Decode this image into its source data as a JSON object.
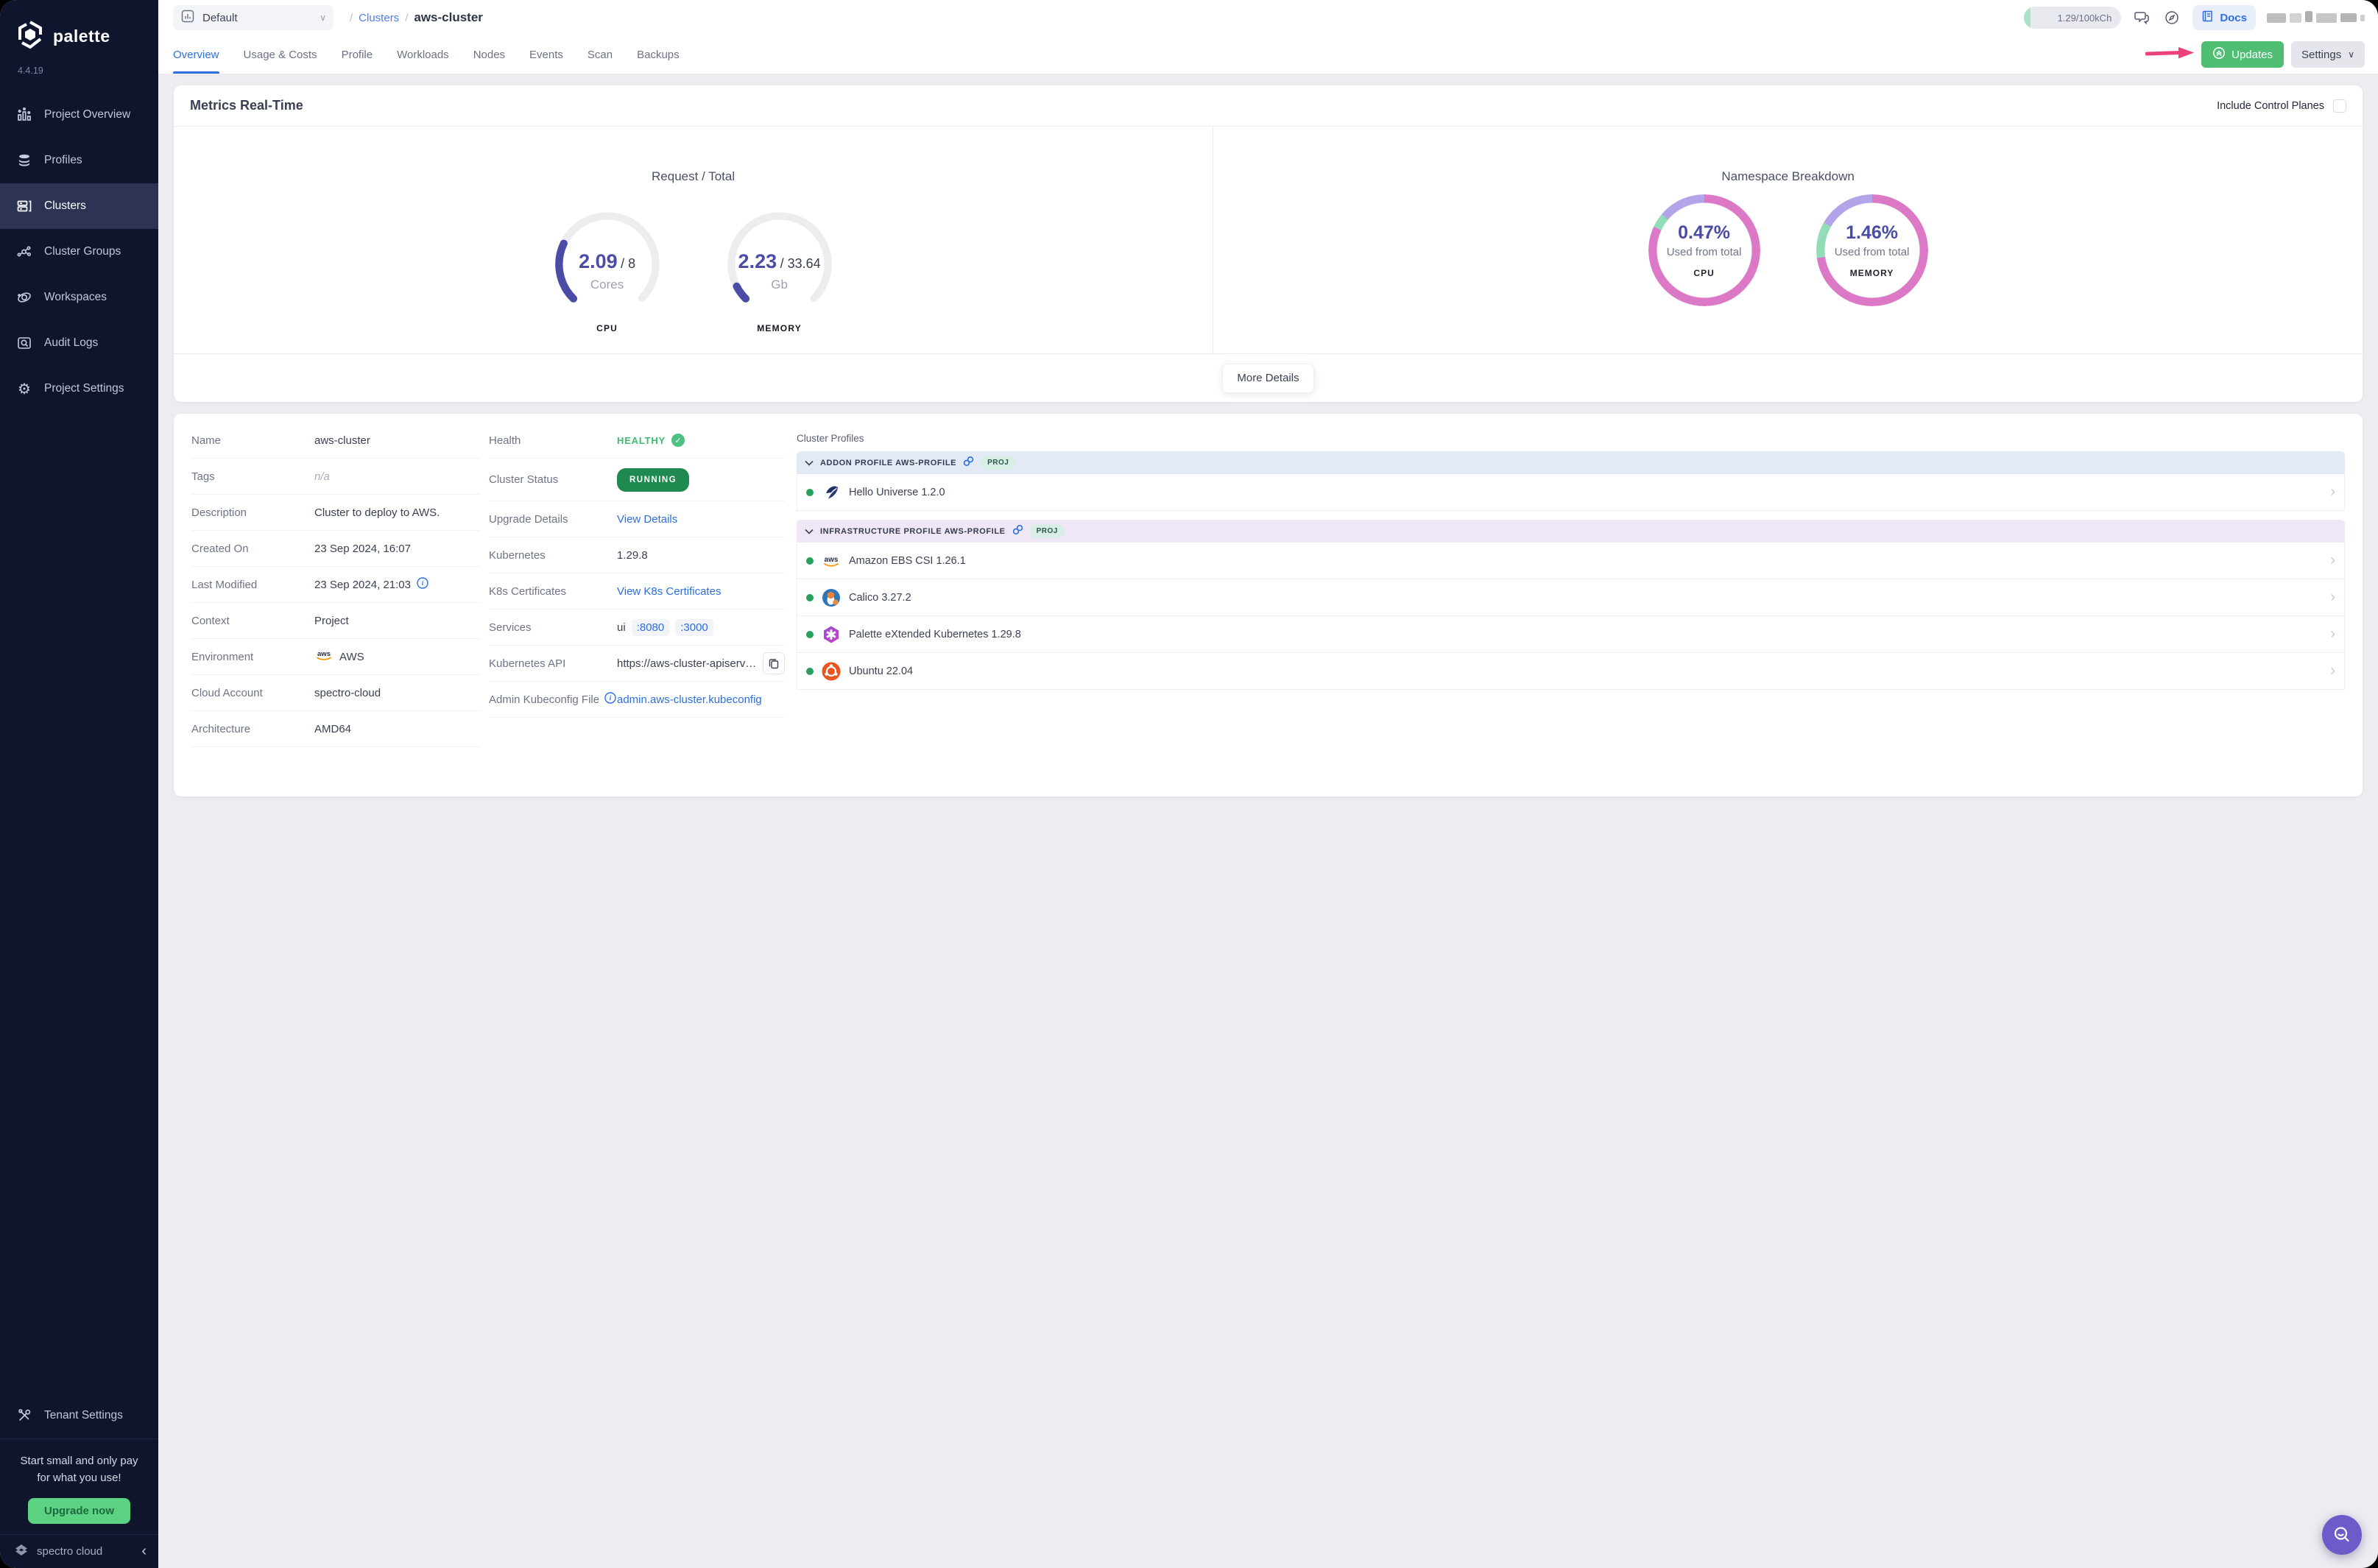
{
  "brand": {
    "name": "palette",
    "version": "4.4.19",
    "footer": "spectro cloud"
  },
  "sidebar": {
    "items": [
      {
        "label": "Project Overview"
      },
      {
        "label": "Profiles"
      },
      {
        "label": "Clusters"
      },
      {
        "label": "Cluster Groups"
      },
      {
        "label": "Workspaces"
      },
      {
        "label": "Audit Logs"
      },
      {
        "label": "Project Settings"
      }
    ],
    "tenant": "Tenant Settings",
    "promo": {
      "line1": "Start small and only pay",
      "line2": "for what you use!",
      "cta": "Upgrade now"
    }
  },
  "topbar": {
    "project": "Default",
    "breadcrumb_sep": "/",
    "breadcrumb_section": "Clusters",
    "breadcrumb_current": "aws-cluster",
    "usage": "1.29/100kCh",
    "docs": "Docs"
  },
  "tabs": {
    "items": [
      "Overview",
      "Usage & Costs",
      "Profile",
      "Workloads",
      "Nodes",
      "Events",
      "Scan",
      "Backups"
    ],
    "updates": "Updates",
    "settings": "Settings"
  },
  "metrics": {
    "title": "Metrics Real-Time",
    "include_control_planes_label": "Include Control Planes",
    "include_control_planes_checked": false,
    "left_title": "Request / Total",
    "right_title": "Namespace Breakdown",
    "gauges": [
      {
        "metric": "CPU",
        "used": 2.09,
        "total": 8,
        "used_label": "2.09",
        "total_label": "/ 8",
        "unit": "Cores"
      },
      {
        "metric": "MEMORY",
        "used": 2.23,
        "total": 33.64,
        "used_label": "2.23",
        "total_label": "/ 33.64",
        "unit": "Gb"
      }
    ],
    "rings": [
      {
        "metric": "CPU",
        "percent": "0.47%",
        "caption": "Used from total",
        "segments": [
          [
            "#DC79C6",
            0,
            295
          ],
          [
            "#92DCB7",
            295,
            310
          ],
          [
            "#B3A3E8",
            310,
            360
          ]
        ]
      },
      {
        "metric": "MEMORY",
        "percent": "1.46%",
        "caption": "Used from total",
        "segments": [
          [
            "#DC79C6",
            0,
            262
          ],
          [
            "#92DCB7",
            262,
            300
          ],
          [
            "#B3A3E8",
            300,
            360
          ]
        ]
      }
    ],
    "more_details": "More Details"
  },
  "details": {
    "rows": [
      {
        "label": "Name",
        "value": "aws-cluster"
      },
      {
        "label": "Tags",
        "value": "n/a"
      },
      {
        "label": "Description",
        "value": "Cluster to deploy to AWS."
      },
      {
        "label": "Created On",
        "value": "23 Sep 2024, 16:07"
      },
      {
        "label": "Last Modified",
        "value": "23 Sep 2024, 21:03"
      },
      {
        "label": "Context",
        "value": "Project"
      },
      {
        "label": "Environment",
        "value": "AWS"
      },
      {
        "label": "Cloud Account",
        "value": "spectro-cloud"
      },
      {
        "label": "Architecture",
        "value": "AMD64"
      }
    ]
  },
  "cluster_status": {
    "health_label": "Health",
    "health_value": "HEALTHY",
    "status_label": "Cluster Status",
    "status_value": "RUNNING",
    "upgrade_label": "Upgrade Details",
    "upgrade_value": "View Details",
    "k8s_label": "Kubernetes",
    "k8s_value": "1.29.8",
    "cert_label": "K8s Certificates",
    "cert_value": "View K8s Certificates",
    "services_label": "Services",
    "services_name": "ui",
    "services_ports": [
      ":8080",
      ":3000"
    ],
    "api_label": "Kubernetes API",
    "api_value": "https://aws-cluster-apiserve...",
    "kubeconfig_label": "Admin Kubeconfig File",
    "kubeconfig_value": "admin.aws-cluster.kubeconfig"
  },
  "profiles": {
    "heading": "Cluster Profiles",
    "groups": [
      {
        "title": "ADDON PROFILE AWS-PROFILE",
        "badge": "PROJ",
        "items": [
          {
            "name": "Hello Universe 1.2.0"
          }
        ]
      },
      {
        "title": "INFRASTRUCTURE PROFILE AWS-PROFILE",
        "badge": "PROJ",
        "items": [
          {
            "name": "Amazon EBS CSI 1.26.1"
          },
          {
            "name": "Calico 3.27.2"
          },
          {
            "name": "Palette eXtended Kubernetes 1.29.8"
          },
          {
            "name": "Ubuntu 22.04"
          }
        ]
      }
    ]
  },
  "colors": {
    "accent_blue": "#2D6FE0",
    "updates_green": "#4FBE72",
    "running_green": "#1E8A4F",
    "healthy_green": "#3EBD72",
    "gauge_purple": "#4A4CA6",
    "ring_pink": "#DC79C6",
    "ring_mint": "#92DCB7",
    "ring_lavender": "#B3A3E8",
    "sidebar_bg": "#10152E",
    "upgrade_green": "#5ED283",
    "arrow_pink": "#ED4179",
    "fab_purple": "#6C5BC9"
  }
}
